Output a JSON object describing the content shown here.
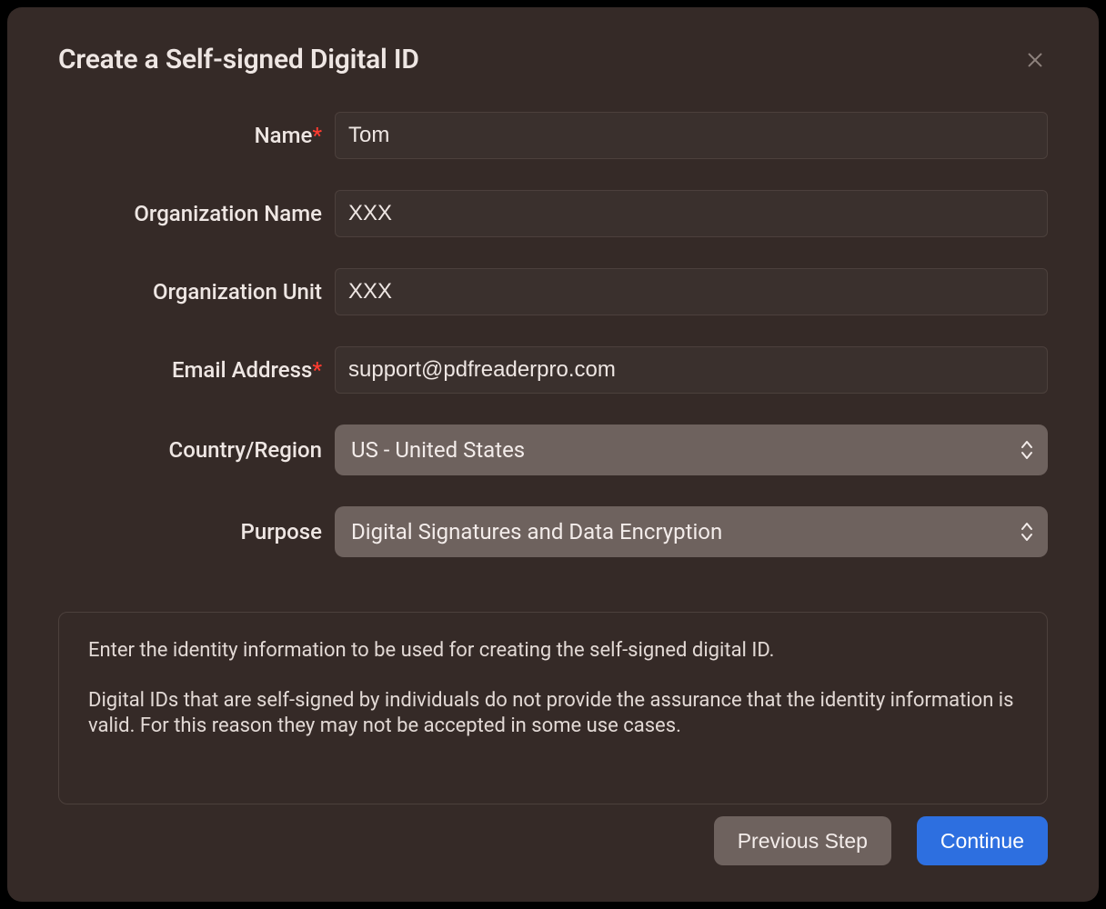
{
  "dialog": {
    "title": "Create a Self-signed Digital ID",
    "required_marker": "*"
  },
  "fields": {
    "name": {
      "label": "Name",
      "required": true,
      "value": "Tom"
    },
    "org_name": {
      "label": "Organization Name",
      "required": false,
      "value": "XXX"
    },
    "org_unit": {
      "label": "Organization Unit",
      "required": false,
      "value": "XXX"
    },
    "email": {
      "label": "Email Address",
      "required": true,
      "value": "support@pdfreaderpro.com"
    },
    "country": {
      "label": "Country/Region",
      "selected": "US - United States"
    },
    "purpose": {
      "label": "Purpose",
      "selected": "Digital Signatures and Data Encryption"
    }
  },
  "info": {
    "line1": "Enter the identity information to be used for creating the self-signed digital ID.",
    "line2": "Digital IDs that are self-signed by individuals do not provide the assurance that the identity information is valid. For this reason they may not be accepted in some use cases."
  },
  "buttons": {
    "previous": "Previous Step",
    "continue": "Continue"
  }
}
